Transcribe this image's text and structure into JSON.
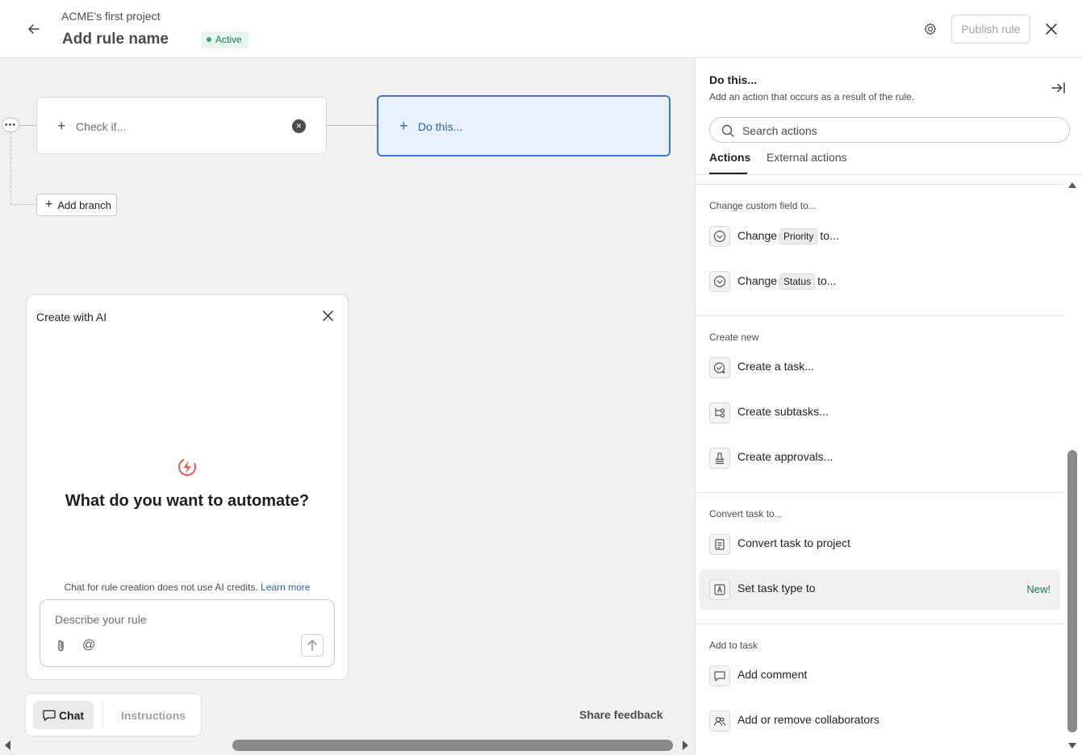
{
  "header": {
    "project_name": "ACME's first project",
    "rule_name": "Add rule name",
    "status": "Active",
    "publish_label": "Publish rule"
  },
  "canvas": {
    "check_label": "Check if...",
    "do_label": "Do this...",
    "add_branch_label": "Add branch"
  },
  "ai_panel": {
    "title": "Create with AI",
    "heading": "What do you want to automate?",
    "note": "Chat for rule creation does not use AI credits.",
    "learn_more": "Learn more",
    "input_placeholder": "Describe your rule",
    "tabs": {
      "chat": "Chat",
      "instructions": "Instructions"
    },
    "share_feedback": "Share feedback"
  },
  "right_panel": {
    "title": "Do this...",
    "subtitle": "Add an action that occurs as a result of the rule.",
    "search_placeholder": "Search actions",
    "tabs": [
      "Actions",
      "External actions"
    ],
    "sections": [
      {
        "label": "Change custom field to...",
        "items": [
          {
            "prefix": "Change",
            "chip": "Priority",
            "suffix": "to...",
            "icon": "chevron-circle-icon"
          },
          {
            "prefix": "Change",
            "chip": "Status",
            "suffix": "to...",
            "icon": "chevron-circle-icon"
          }
        ]
      },
      {
        "label": "Create new",
        "items": [
          {
            "text": "Create a task...",
            "icon": "task-add-icon"
          },
          {
            "text": "Create subtasks...",
            "icon": "subtasks-icon"
          },
          {
            "text": "Create approvals...",
            "icon": "approval-icon"
          }
        ]
      },
      {
        "label": "Convert task to...",
        "items": [
          {
            "text": "Convert task to project",
            "icon": "project-icon"
          },
          {
            "text": "Set task type to",
            "icon": "task-type-icon",
            "badge": "New!"
          }
        ]
      },
      {
        "label": "Add to task",
        "items": [
          {
            "text": "Add comment",
            "icon": "comment-icon"
          },
          {
            "text": "Add or remove collaborators",
            "icon": "collaborators-icon"
          }
        ]
      }
    ]
  },
  "colors": {
    "accent_blue": "#3f74d2",
    "success_green": "#1f7a4d"
  }
}
